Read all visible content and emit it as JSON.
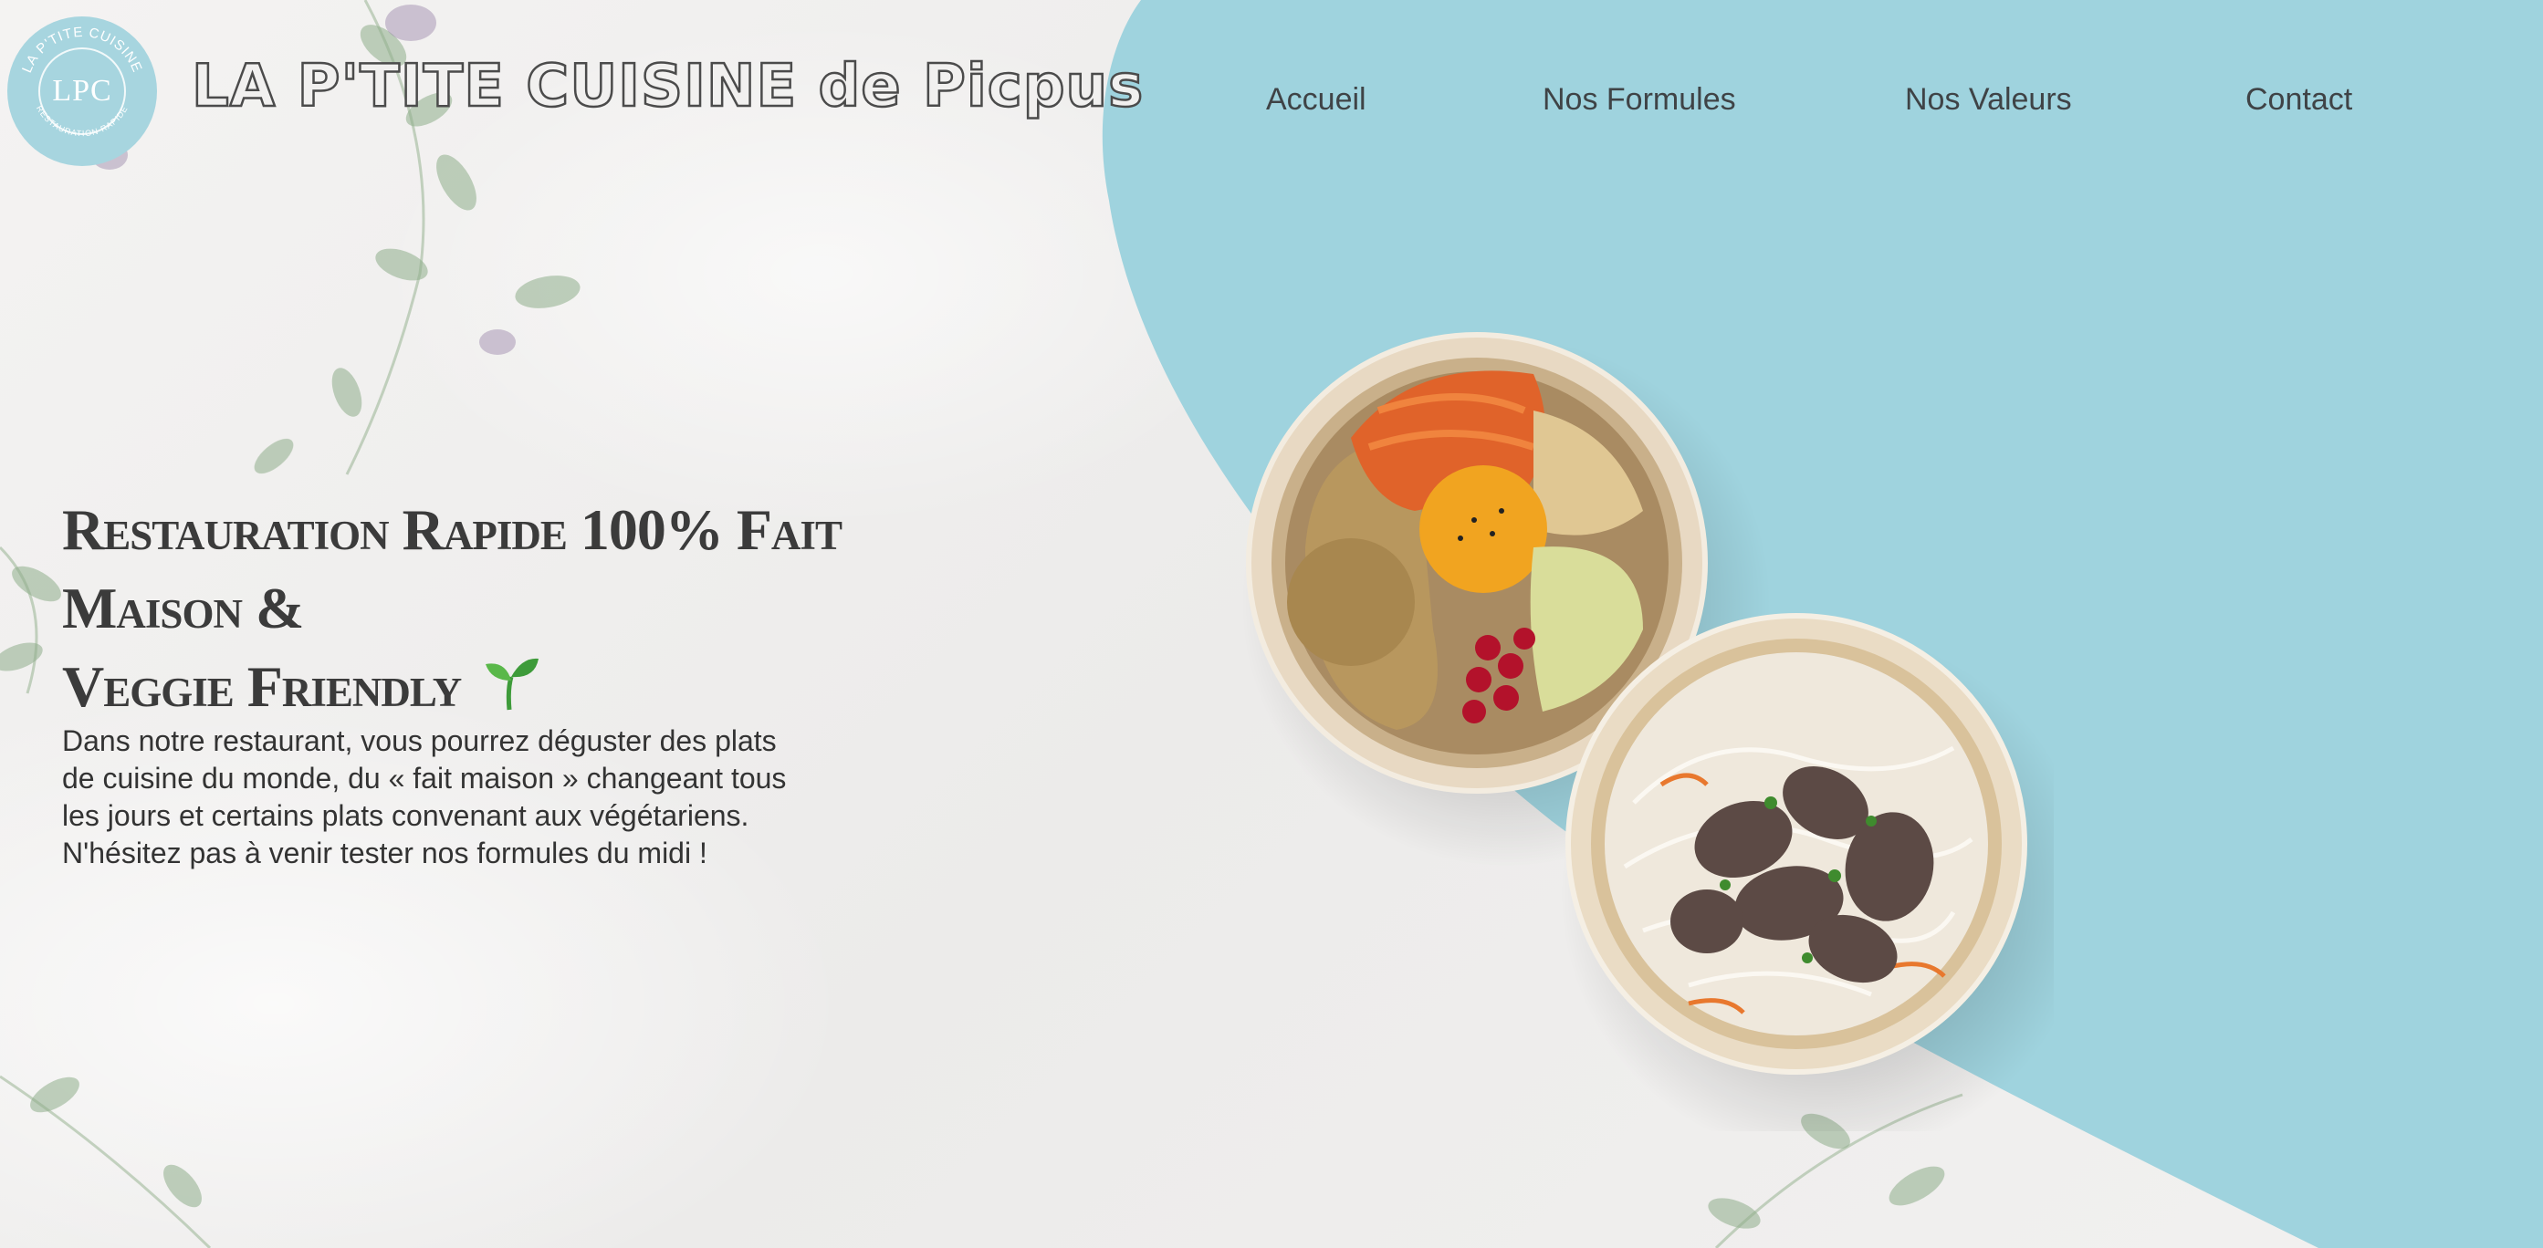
{
  "brand": {
    "logo_text": "LPC",
    "logo_ring_top": "LA P'TITE CUISINE",
    "logo_ring_bottom": "RESTAURATION RAPIDE",
    "title": "LA P'TITE CUISINE de Picpus"
  },
  "nav": {
    "items": [
      {
        "label": "Accueil"
      },
      {
        "label": "Nos Formules"
      },
      {
        "label": "Nos Valeurs"
      },
      {
        "label": "Contact"
      }
    ]
  },
  "hero": {
    "headline_line1": "Restauration Rapide 100% Fait Maison &",
    "headline_line2": "Veggie Friendly",
    "description": "Dans notre restaurant, vous pourrez déguster des plats de cuisine du monde, du « fait maison » changeant tous les jours et certains plats convenant aux végétariens. N'hésitez pas à venir tester nos formules du midi !"
  },
  "colors": {
    "accent": "#9fd3de",
    "text": "#3f4346",
    "background": "#f1f0ef"
  },
  "icons": {
    "sprout": "sprout-icon",
    "logo": "lpc-logo"
  }
}
